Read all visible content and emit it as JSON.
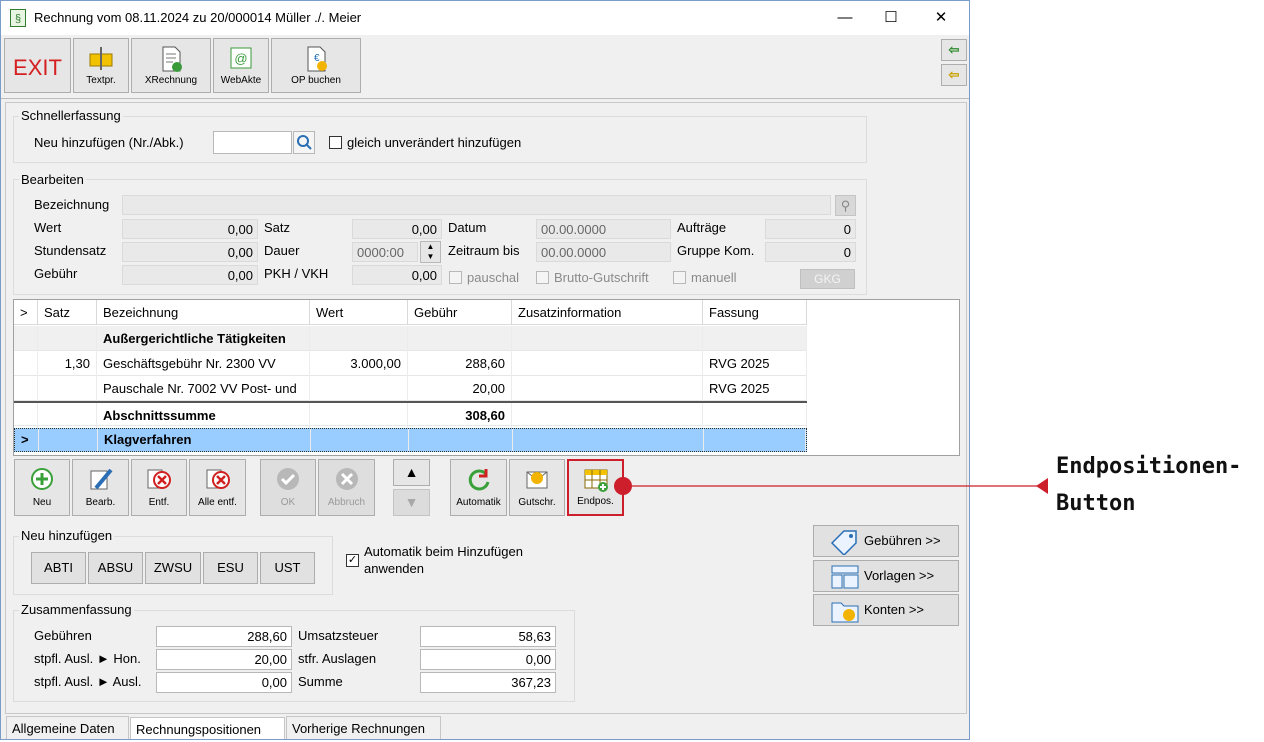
{
  "window": {
    "title": "Rechnung vom 08.11.2024 zu 20/000014  Müller ./. Meier",
    "app_icon": "§",
    "min_label": "—",
    "max_label": "☐",
    "close_label": "✕"
  },
  "toolbar": {
    "exit_label": "EXIT",
    "textpr_label": "Textpr.",
    "xrechnung_label": "XRechnung",
    "webakte_label": "WebAkte",
    "opbuchen_label": "OP buchen"
  },
  "schnellerfassung": {
    "title": "Schnellerfassung",
    "neu_label": "Neu hinzufügen (Nr./Abk.)",
    "neu_value": "",
    "gleich_label": "gleich unverändert hinzufügen"
  },
  "bearbeiten": {
    "title": "Bearbeiten",
    "bezeichnung_label": "Bezeichnung",
    "bezeichnung_value": "",
    "wert_label": "Wert",
    "wert_value": "0,00",
    "stundensatz_label": "Stundensatz",
    "stundensatz_value": "0,00",
    "gebuehr_label": "Gebühr",
    "gebuehr_value": "0,00",
    "satz_label": "Satz",
    "satz_value": "0,00",
    "dauer_label": "Dauer",
    "dauer_value": "0000:00",
    "pkh_label": "PKH / VKH",
    "pkh_value": "0,00",
    "datum_label": "Datum",
    "datum_value": "00.00.0000",
    "zeitraum_label": "Zeitraum bis",
    "zeitraum_value": "00.00.0000",
    "auftraege_label": "Aufträge",
    "auftraege_value": "0",
    "gruppe_label": "Gruppe Kom.",
    "gruppe_value": "0",
    "pauschal_label": "pauschal",
    "brutto_label": "Brutto-Gutschrift",
    "manuell_label": "manuell",
    "gkg_label": "GKG"
  },
  "grid": {
    "headers": [
      ">",
      "Satz",
      "Bezeichnung",
      "Wert",
      "Gebühr",
      "Zusatzinformation",
      "Fassung"
    ],
    "rows": [
      {
        "marker": "",
        "satz": "",
        "bezeichnung": "Außergerichtliche Tätigkeiten",
        "wert": "",
        "gebuehr": "",
        "zusatz": "",
        "fassung": ""
      },
      {
        "marker": "",
        "satz": "1,30",
        "bezeichnung": "Geschäftsgebühr Nr. 2300 VV",
        "wert": "3.000,00",
        "gebuehr": "288,60",
        "zusatz": "",
        "fassung": "RVG 2025"
      },
      {
        "marker": "",
        "satz": "",
        "bezeichnung": "Pauschale Nr. 7002 VV Post- und",
        "wert": "",
        "gebuehr": "20,00",
        "zusatz": "",
        "fassung": "RVG 2025"
      },
      {
        "marker": "",
        "satz": "",
        "bezeichnung": "Abschnittssumme",
        "wert": "",
        "gebuehr": "308,60",
        "zusatz": "",
        "fassung": ""
      },
      {
        "marker": ">",
        "satz": "",
        "bezeichnung": "Klagverfahren",
        "wert": "",
        "gebuehr": "",
        "zusatz": "",
        "fassung": ""
      }
    ]
  },
  "actions": {
    "neu": "Neu",
    "bearb": "Bearb.",
    "entf": "Entf.",
    "alle_entf": "Alle entf.",
    "ok": "OK",
    "abbruch": "Abbruch",
    "automatik": "Automatik",
    "gutschr": "Gutschr.",
    "endpos": "Endpos."
  },
  "neu_hinzufuegen": {
    "title": "Neu hinzufügen",
    "buttons": [
      "ABTI",
      "ABSU",
      "ZWSU",
      "ESU",
      "UST"
    ],
    "automatik_line1": "Automatik beim Hinzufügen",
    "automatik_line2": "anwenden",
    "automatik_checked": true
  },
  "side_buttons": {
    "gebuehren": "Gebühren >>",
    "vorlagen": "Vorlagen >>",
    "konten": "Konten >>"
  },
  "zusammenfassung": {
    "title": "Zusammenfassung",
    "gebuehren_label": "Gebühren",
    "gebuehren_value": "288,60",
    "hon_label": "stpfl. Ausl. ► Hon.",
    "hon_value": "20,00",
    "ausl_label": "stpfl. Ausl. ► Ausl.",
    "ausl_value": "0,00",
    "ust_label": "Umsatzsteuer",
    "ust_value": "58,63",
    "stfr_label": "stfr. Auslagen",
    "stfr_value": "0,00",
    "summe_label": "Summe",
    "summe_value": "367,23"
  },
  "tabs": [
    "Allgemeine Daten",
    "Rechnungspositionen",
    "Vorherige Rechnungen"
  ],
  "annotation": {
    "line1": "Endpositionen-",
    "line2": "Button",
    "color": "#cc1e2b"
  }
}
